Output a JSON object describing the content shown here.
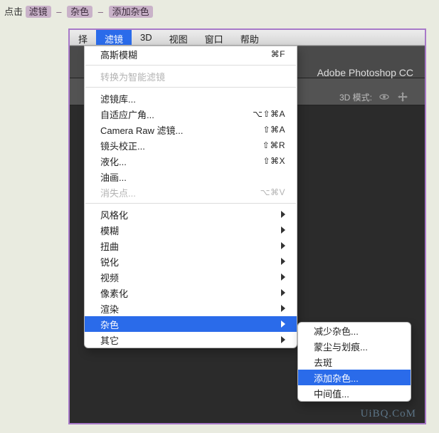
{
  "instruction": {
    "prefix": "点击",
    "step1": "滤镜",
    "step2": "杂色",
    "step3": "添加杂色"
  },
  "menubar": {
    "items": [
      "择",
      "滤镜",
      "3D",
      "视图",
      "窗口",
      "帮助"
    ],
    "activeIndex": 1
  },
  "ps": {
    "title": "Adobe Photoshop CC",
    "mode_label": "3D 模式:"
  },
  "filter_menu": {
    "last": {
      "label": "高斯模糊",
      "shortcut": "⌘F"
    },
    "smart": "转换为智能滤镜",
    "gallery": "滤镜库...",
    "adaptive": {
      "label": "自适应广角...",
      "shortcut": "⌥⇧⌘A"
    },
    "camera": {
      "label": "Camera Raw 滤镜...",
      "shortcut": "⇧⌘A"
    },
    "lens": {
      "label": "镜头校正...",
      "shortcut": "⇧⌘R"
    },
    "liquify": {
      "label": "液化...",
      "shortcut": "⇧⌘X"
    },
    "oil": "油画...",
    "vanish": {
      "label": "消失点...",
      "shortcut": "⌥⌘V"
    },
    "sub": {
      "stylize": "风格化",
      "blur": "模糊",
      "distort": "扭曲",
      "sharpen": "锐化",
      "video": "视频",
      "pixelate": "像素化",
      "render": "渲染",
      "noise": "杂色",
      "other": "其它"
    }
  },
  "noise_menu": {
    "reduce": "减少杂色...",
    "dust": "蒙尘与划痕...",
    "despeckle": "去斑",
    "add": "添加杂色...",
    "median": "中间值..."
  },
  "watermark": "UiBQ.CoM"
}
